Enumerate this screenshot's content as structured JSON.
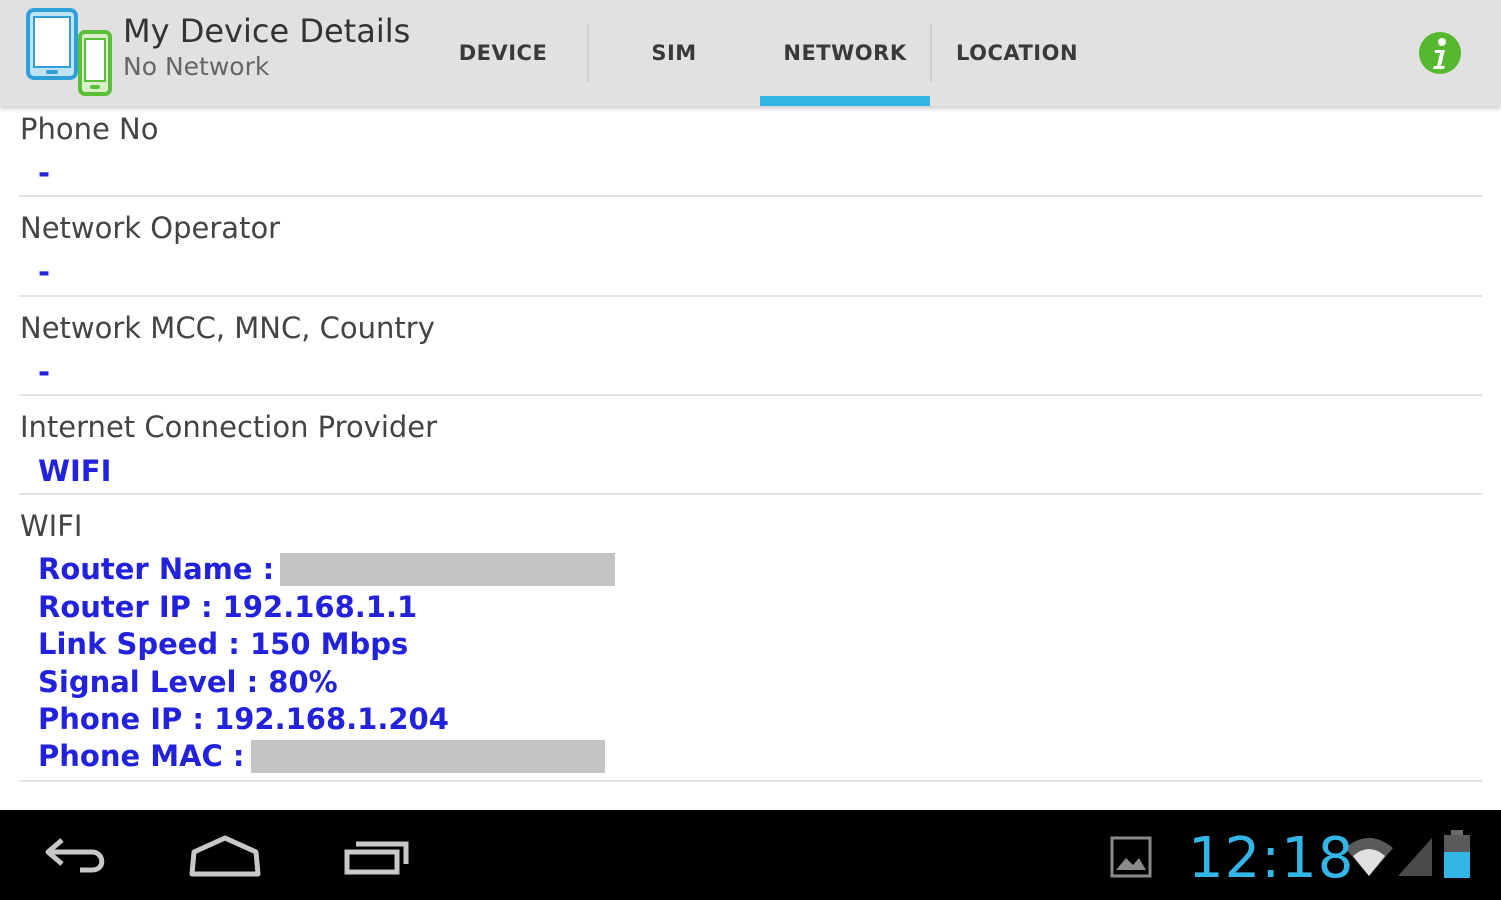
{
  "app": {
    "title": "My Device Details",
    "subtitle": "No Network"
  },
  "tabs": [
    {
      "label": "DEVICE",
      "active": false
    },
    {
      "label": "SIM",
      "active": false
    },
    {
      "label": "NETWORK",
      "active": true
    },
    {
      "label": "LOCATION",
      "active": false
    }
  ],
  "rows": {
    "phone_no": {
      "label": "Phone No",
      "value": "-"
    },
    "network_operator": {
      "label": "Network Operator",
      "value": "-"
    },
    "mcc_mnc": {
      "label": "Network MCC, MNC, Country",
      "value": "-"
    },
    "provider": {
      "label": "Internet Connection Provider",
      "value": "WIFI"
    },
    "wifi": {
      "label": "WIFI",
      "router_name": "Router Name :",
      "router_ip": "Router IP : 192.168.1.1",
      "link_speed": "Link Speed : 150 Mbps",
      "signal_level": "Signal Level : 80%",
      "phone_ip": "Phone IP : 192.168.1.204",
      "phone_mac": "Phone MAC :"
    }
  },
  "system": {
    "clock": "12:18"
  },
  "colors": {
    "accent": "#33b5e5",
    "value_text": "#2222dd",
    "info_icon": "#55b82e",
    "actionbar": "#e1e1e1"
  },
  "icons": {
    "app": "devices-icon",
    "info": "info-icon",
    "back": "back-icon",
    "home": "home-icon",
    "recents": "recent-apps-icon",
    "gallery": "gallery-notification-icon",
    "wifi": "wifi-signal-icon",
    "cell": "cell-signal-icon",
    "battery": "battery-icon"
  }
}
